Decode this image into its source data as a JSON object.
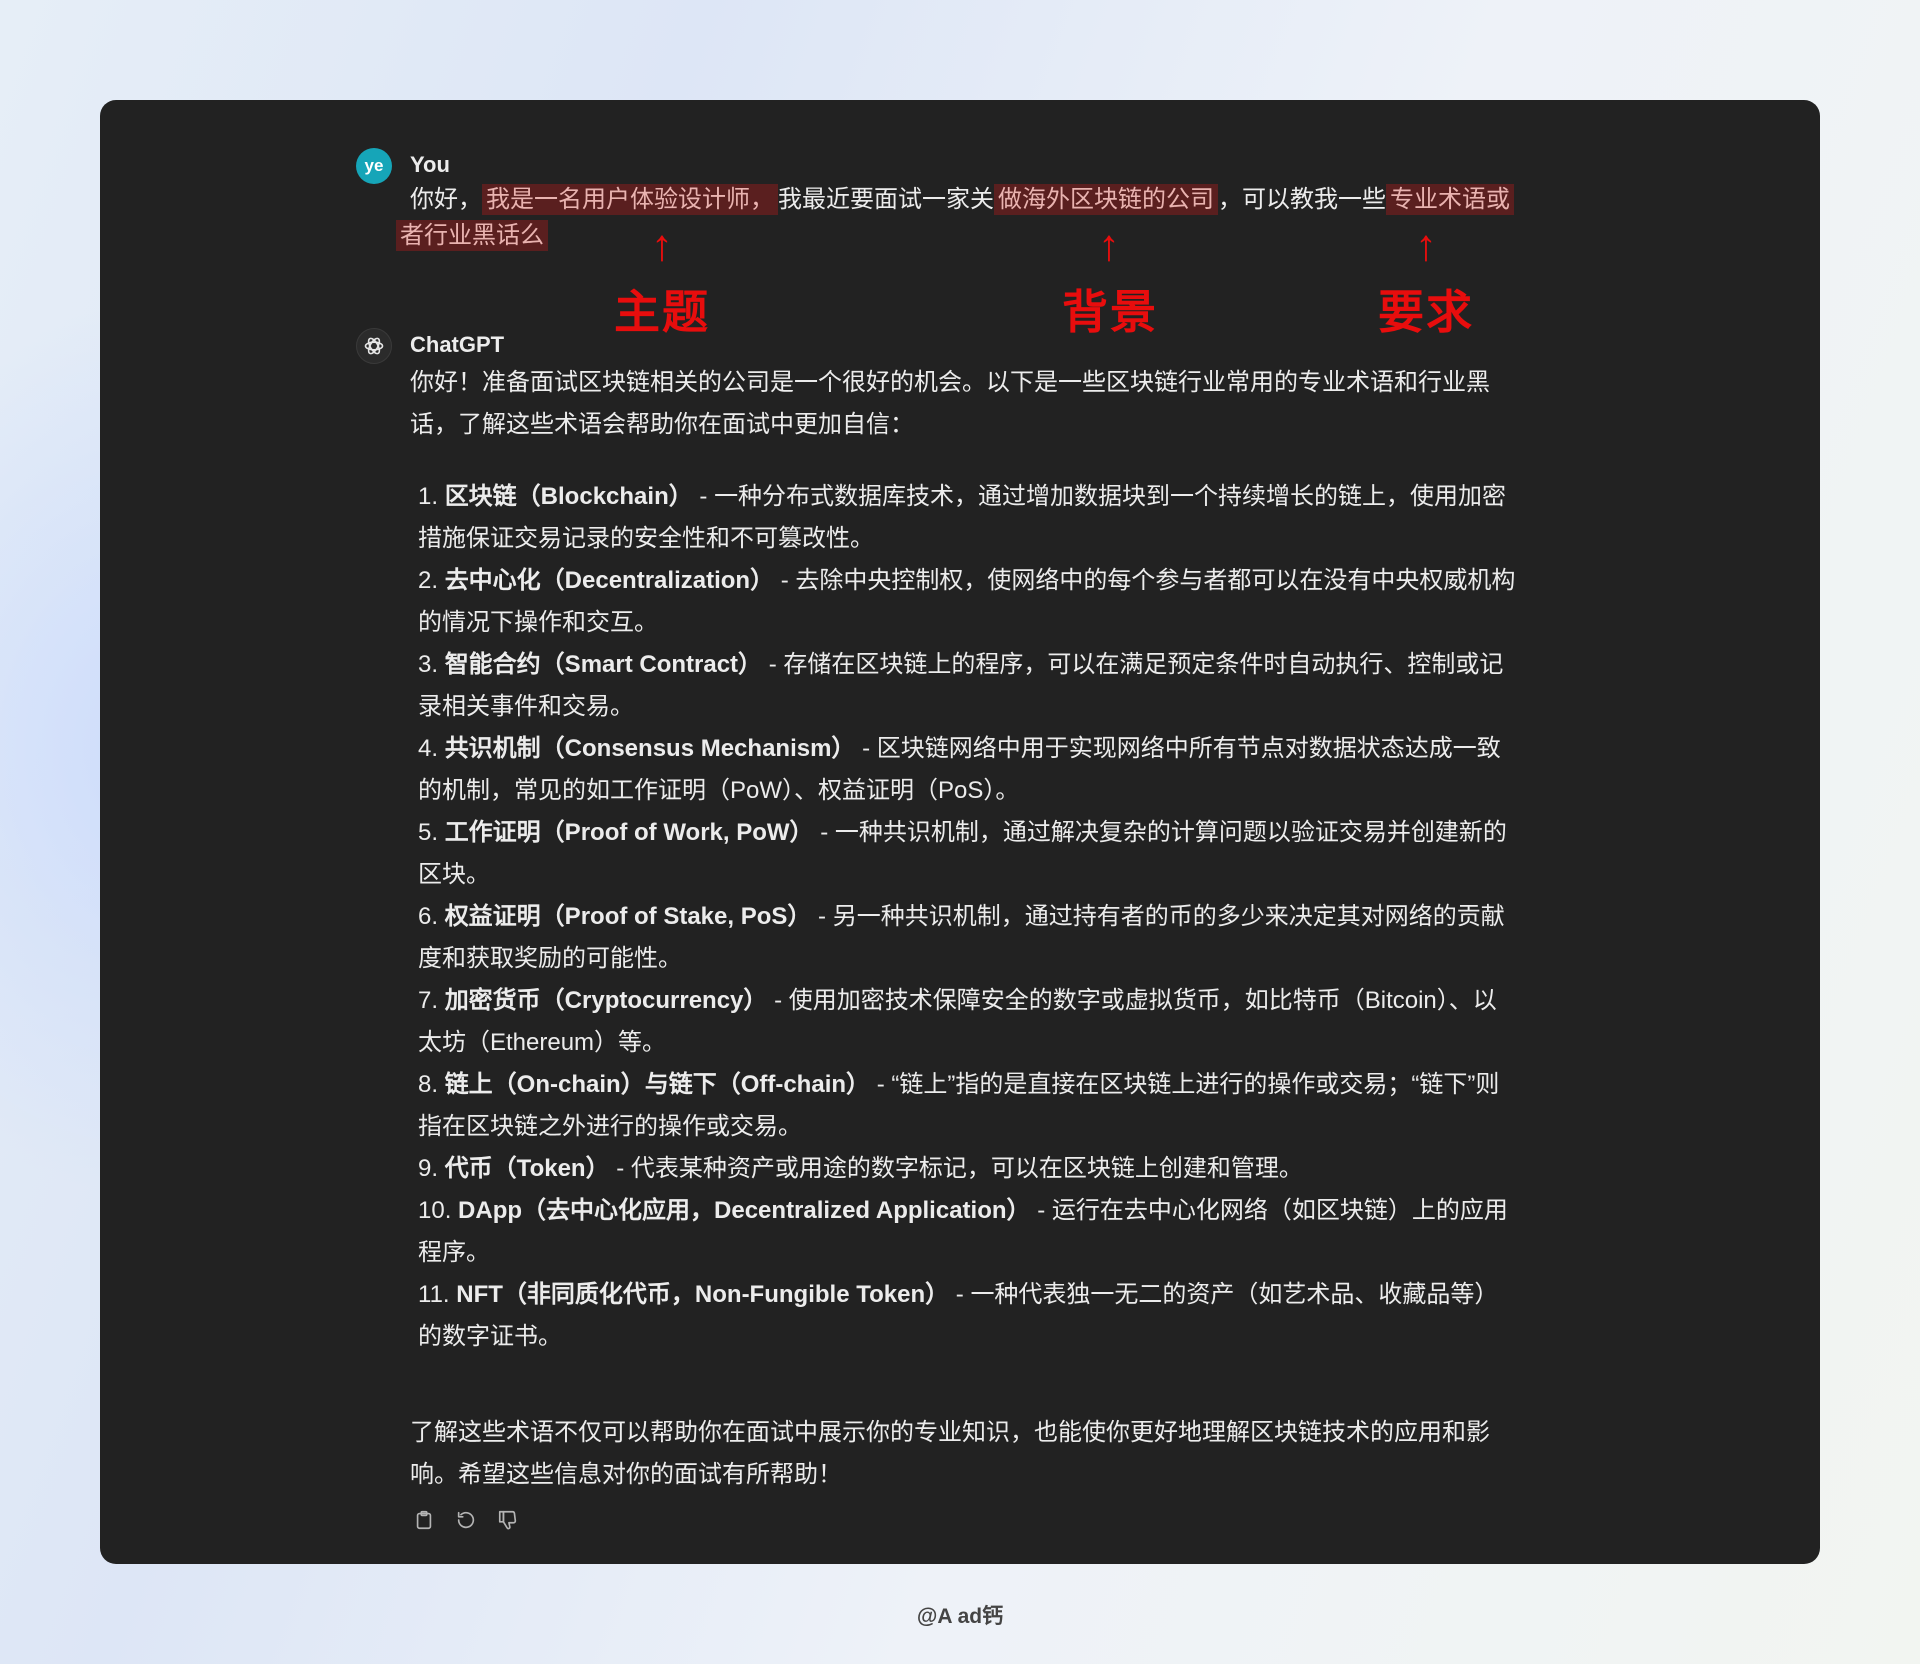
{
  "user_message": {
    "avatar": "ye",
    "name": "You",
    "parts": {
      "p1": "你好，",
      "p2": "我是一名用户体验设计师，",
      "p3": "我最近要面试一家关",
      "p4": "做海外区块链的公司",
      "p5": "，可以教我一些",
      "p6": "专业术语或",
      "p7": "者行业黑话么"
    }
  },
  "annotations": {
    "color": "#e80d0d",
    "arrow": "↑",
    "items": [
      {
        "label": "主题"
      },
      {
        "label": "背景"
      },
      {
        "label": "要求"
      }
    ]
  },
  "assistant_message": {
    "name": "ChatGPT",
    "avatar_icon": "openai-logo-icon",
    "intro": "你好！准备面试区块链相关的公司是一个很好的机会。以下是一些区块链行业常用的专业术语和行业黑话，了解这些术语会帮助你在面试中更加自信：",
    "terms": [
      {
        "num": "1.",
        "term": "区块链（Blockchain）",
        "desc": " - 一种分布式数据库技术，通过增加数据块到一个持续增长的链上，使用加密措施保证交易记录的安全性和不可篡改性。"
      },
      {
        "num": "2.",
        "term": "去中心化（Decentralization）",
        "desc": " - 去除中央控制权，使网络中的每个参与者都可以在没有中央权威机构的情况下操作和交互。"
      },
      {
        "num": "3.",
        "term": "智能合约（Smart Contract）",
        "desc": " - 存储在区块链上的程序，可以在满足预定条件时自动执行、控制或记录相关事件和交易。"
      },
      {
        "num": "4.",
        "term": "共识机制（Consensus Mechanism）",
        "desc": " - 区块链网络中用于实现网络中所有节点对数据状态达成一致的机制，常见的如工作证明（PoW）、权益证明（PoS）。"
      },
      {
        "num": "5.",
        "term": "工作证明（Proof of Work, PoW）",
        "desc": " - 一种共识机制，通过解决复杂的计算问题以验证交易并创建新的区块。"
      },
      {
        "num": "6.",
        "term": "权益证明（Proof of Stake, PoS）",
        "desc": " - 另一种共识机制，通过持有者的币的多少来决定其对网络的贡献度和获取奖励的可能性。"
      },
      {
        "num": "7.",
        "term": "加密货币（Cryptocurrency）",
        "desc": " - 使用加密技术保障安全的数字或虚拟货币，如比特币（Bitcoin）、以太坊（Ethereum）等。"
      },
      {
        "num": "8.",
        "term": "链上（On-chain）与链下（Off-chain）",
        "desc": " - “链上”指的是直接在区块链上进行的操作或交易；“链下”则指在区块链之外进行的操作或交易。"
      },
      {
        "num": "9.",
        "term": "代币（Token）",
        "desc": " - 代表某种资产或用途的数字标记，可以在区块链上创建和管理。"
      },
      {
        "num": "10.",
        "term": "DApp（去中心化应用，Decentralized Application）",
        "desc": " - 运行在去中心化网络（如区块链）上的应用程序。"
      },
      {
        "num": "11.",
        "term": "NFT（非同质化代币，Non-Fungible Token）",
        "desc": " - 一种代表独一无二的资产（如艺术品、收藏品等）的数字证书。"
      }
    ],
    "outro": "了解这些术语不仅可以帮助你在面试中展示你的专业知识，也能使你更好地理解区块链技术的应用和影响。希望这些信息对你的面试有所帮助！",
    "actions": [
      "copy-icon",
      "regenerate-icon",
      "thumbs-down-icon"
    ]
  },
  "footer": {
    "credit": "@A ad钙"
  }
}
